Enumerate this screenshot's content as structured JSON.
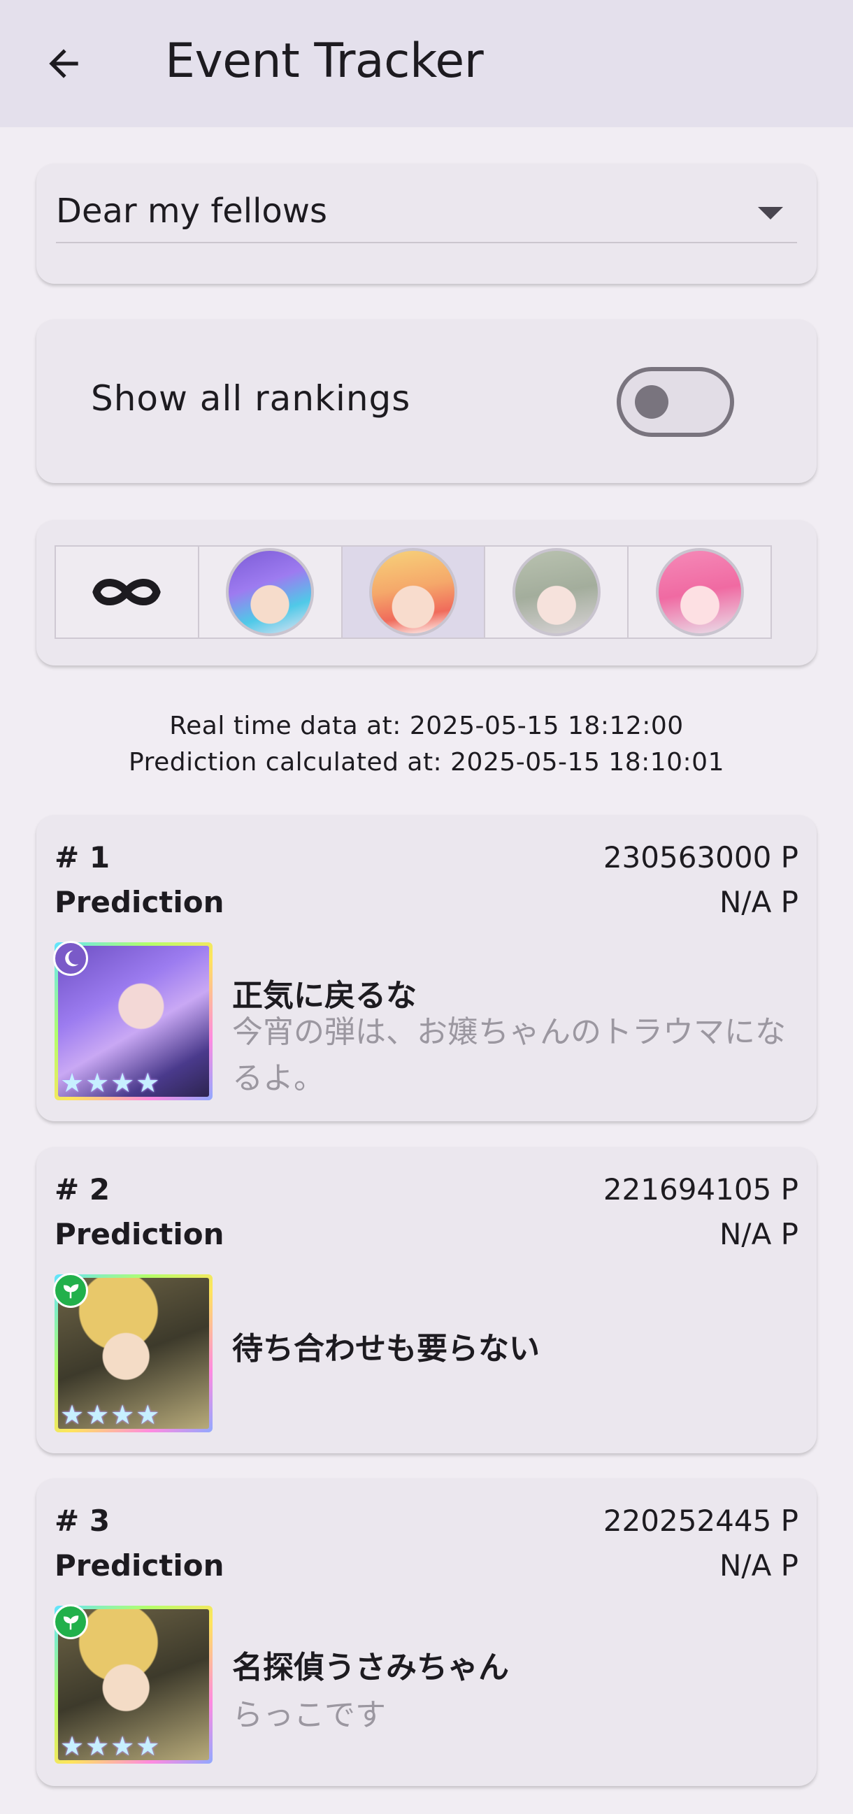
{
  "appbar": {
    "title": "Event Tracker",
    "back_icon": "arrow-back-icon"
  },
  "event_select": {
    "value": "Dear my fellows"
  },
  "toggle": {
    "label": "Show all rankings",
    "checked": false
  },
  "character_filter": {
    "options": [
      "all",
      "character-1",
      "character-2",
      "character-3",
      "character-4"
    ],
    "selected_index": 2
  },
  "timestamps": {
    "realtime": "Real time data at: 2025-05-15 18:12:00",
    "prediction": "Prediction calculated at: 2025-05-15 18:10:01"
  },
  "rankings": [
    {
      "rank": "# 1",
      "points": "230563000 P",
      "prediction_label": "Prediction",
      "prediction": "N/A P",
      "title": "正気に戻るな",
      "subtitle": "今宵の弾は、お嬢ちゃんのトラウマになるよ。",
      "attribute": "night",
      "stars": 4
    },
    {
      "rank": "# 2",
      "points": "221694105 P",
      "prediction_label": "Prediction",
      "prediction": "N/A P",
      "title": "待ち合わせも要らない",
      "subtitle": "",
      "attribute": "pure",
      "stars": 4
    },
    {
      "rank": "# 3",
      "points": "220252445 P",
      "prediction_label": "Prediction",
      "prediction": "N/A P",
      "title": "名探偵うさみちゃん",
      "subtitle": "らっこです",
      "attribute": "pure",
      "stars": 4
    }
  ],
  "colors": {
    "appbar_bg": "#e4e0ec",
    "page_bg": "#f1edf3",
    "card_bg": "#ebe7ee",
    "selected_segment": "#ddd8e9",
    "pure_badge": "#22b04b",
    "night_badge": "#7a5ac8"
  }
}
